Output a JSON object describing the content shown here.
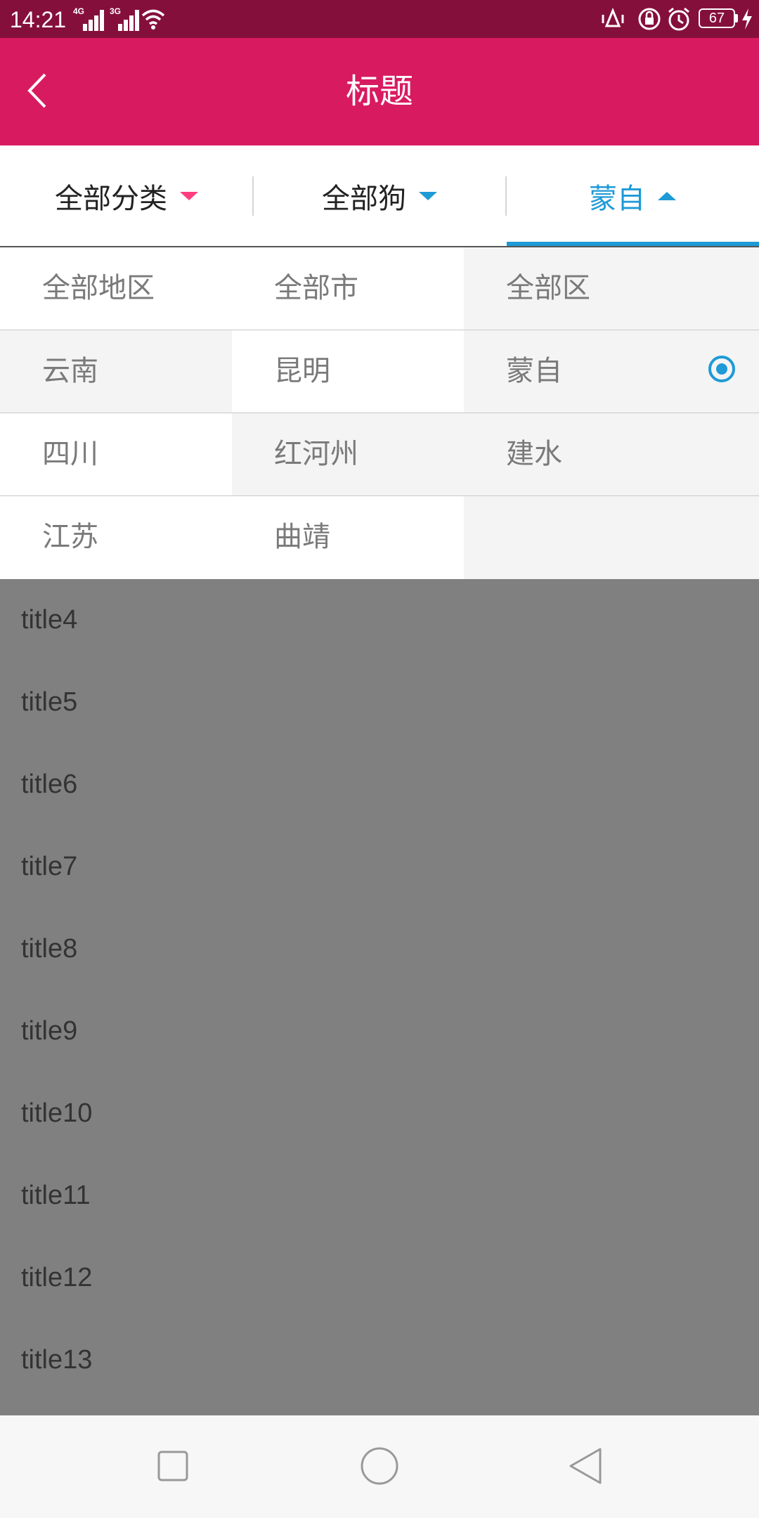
{
  "status_bar": {
    "time": "14:21",
    "signal_1_network": "4G",
    "signal_2_network": "3G",
    "battery_level": "67",
    "icons": [
      "signal-icon",
      "wifi-icon",
      "vibrate-icon",
      "rotation-lock-icon",
      "alarm-icon",
      "battery-icon",
      "charging-icon"
    ]
  },
  "header": {
    "title": "标题",
    "back_icon": "chevron-left-icon",
    "background_color": "#d81b60"
  },
  "filter_tabs": [
    {
      "label": "全部分类",
      "indicator": "triangle-down",
      "color": "#ff3d7f",
      "active": false
    },
    {
      "label": "全部狗",
      "indicator": "triangle-down",
      "color": "#1e9ad6",
      "active": false
    },
    {
      "label": "蒙自",
      "indicator": "triangle-up",
      "color": "#1e9ad6",
      "active": true
    }
  ],
  "region_panel": {
    "provinces": [
      "全部地区",
      "云南",
      "四川",
      "江苏"
    ],
    "cities": [
      "全部市",
      "昆明",
      "红河州",
      "曲靖"
    ],
    "districts": [
      "全部区",
      "蒙自",
      "建水"
    ],
    "selected_district": "蒙自",
    "accent_color": "#1e9ad6"
  },
  "list": {
    "items": [
      "title4",
      "title5",
      "title6",
      "title7",
      "title8",
      "title9",
      "title10",
      "title11",
      "title12",
      "title13"
    ]
  },
  "nav_bar": {
    "buttons": [
      "recents-square-icon",
      "home-circle-icon",
      "back-triangle-icon"
    ]
  }
}
